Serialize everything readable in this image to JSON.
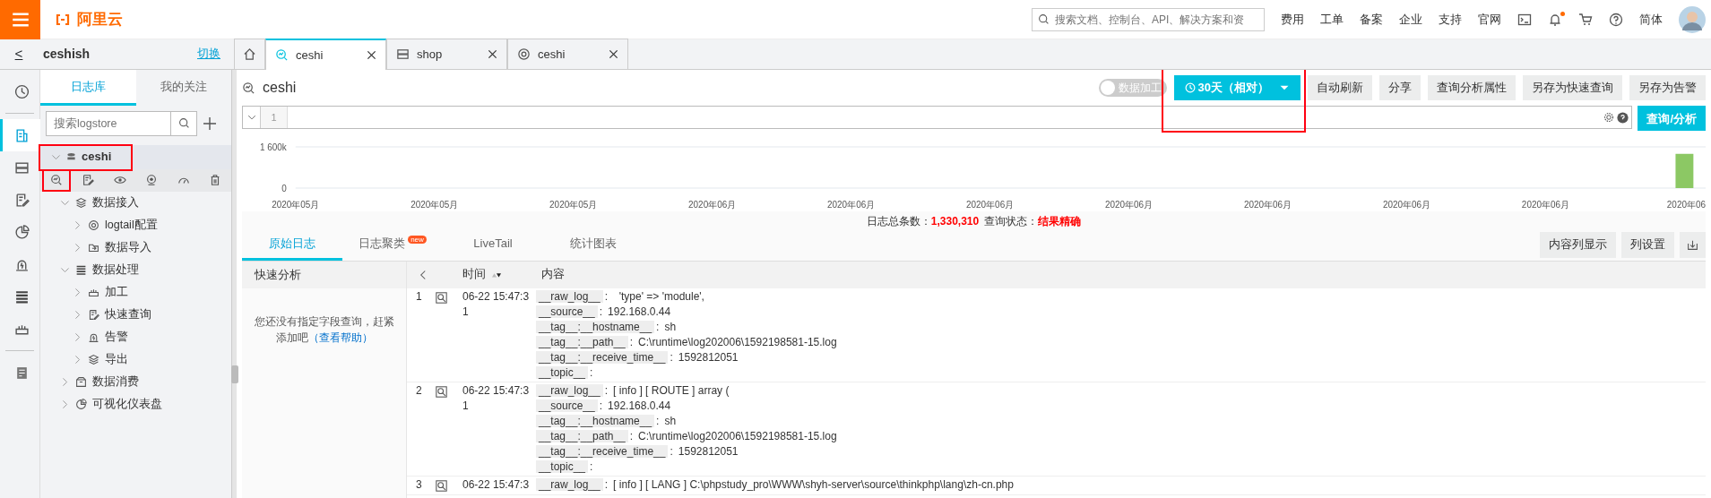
{
  "topbar": {
    "logo": "阿里云",
    "search_placeholder": "搜索文档、控制台、API、解决方案和资",
    "links": [
      "费用",
      "工单",
      "备案",
      "企业",
      "支持",
      "官网"
    ],
    "bell_unread": true,
    "language": "简体"
  },
  "project": {
    "back": "<",
    "name": "ceshish",
    "switch": "切换"
  },
  "tabs": [
    {
      "kind": "home",
      "selected": false,
      "closable": false
    },
    {
      "kind": "search",
      "label": "ceshi",
      "selected": true,
      "closable": true
    },
    {
      "kind": "server",
      "label": "shop",
      "selected": false,
      "closable": true
    },
    {
      "kind": "target",
      "label": "ceshi",
      "selected": false,
      "closable": true
    }
  ],
  "rail": [
    {
      "kind": "clock",
      "selected": false
    },
    {
      "kind": "doc",
      "selected": true
    },
    {
      "kind": "server",
      "selected": false
    },
    {
      "kind": "edit",
      "selected": false
    },
    {
      "kind": "pie",
      "selected": false
    },
    {
      "kind": "alarm",
      "selected": false
    },
    {
      "kind": "list",
      "selected": false
    },
    {
      "kind": "ruler",
      "selected": false
    },
    {
      "kind": "book",
      "selected": false
    }
  ],
  "panel": {
    "tabs": [
      {
        "label": "日志库",
        "selected": true
      },
      {
        "label": "我的关注",
        "selected": false
      }
    ],
    "search_placeholder": "搜索logstore"
  },
  "logstore": {
    "name": "ceshi",
    "expanded": true,
    "annotated": true,
    "actions": [
      {
        "kind": "search",
        "annotated": true
      },
      {
        "kind": "edit",
        "annotated": false
      },
      {
        "kind": "eye",
        "annotated": false
      },
      {
        "kind": "cam",
        "annotated": false
      },
      {
        "kind": "gauge",
        "annotated": false
      },
      {
        "kind": "trash",
        "annotated": false
      }
    ],
    "tree": [
      {
        "label": "数据接入",
        "kind": "stack",
        "expanded": true,
        "children": [
          {
            "label": "logtail配置",
            "kind": "target",
            "expanded": false
          },
          {
            "label": "数据导入",
            "kind": "import",
            "expanded": false
          }
        ]
      },
      {
        "label": "数据处理",
        "kind": "list",
        "expanded": true,
        "children": [
          {
            "label": "加工",
            "kind": "ruler",
            "expanded": false
          },
          {
            "label": "快速查询",
            "kind": "edit",
            "expanded": false
          },
          {
            "label": "告警",
            "kind": "alarm",
            "expanded": false
          },
          {
            "label": "导出",
            "kind": "stack",
            "expanded": false
          }
        ]
      },
      {
        "label": "数据消费",
        "kind": "gift",
        "expanded": false
      },
      {
        "label": "可视化仪表盘",
        "kind": "pie",
        "expanded": false
      }
    ]
  },
  "header": {
    "title": "ceshi",
    "toggle": {
      "label": "数据加工",
      "on": false
    },
    "time_button": {
      "label": "30天（相对）",
      "annotated": true
    },
    "buttons": [
      "自动刷新",
      "分享",
      "查询分析属性",
      "另存为快速查询",
      "另存为告警"
    ]
  },
  "query": {
    "line_number": "1",
    "submit": "查询/分析"
  },
  "histogram": {
    "chart_data": {
      "type": "bar",
      "categories": [
        "2020年05月",
        "2020年05月",
        "2020年05月",
        "2020年06月",
        "2020年06月",
        "2020年06月",
        "2020年06月",
        "2020年06月",
        "2020年06月",
        "2020年06月",
        "2020年06"
      ],
      "yticks": [
        0,
        {
          "value": 1600000,
          "label": "1 600k"
        }
      ],
      "ylim": [
        0,
        1600000
      ],
      "series": [
        {
          "color": "#8cc864",
          "values": [
            null,
            null,
            null,
            null,
            null,
            null,
            null,
            null,
            null,
            null,
            1330000
          ]
        }
      ]
    }
  },
  "summary": {
    "total_label": "日志总条数：",
    "total": "1,330,310",
    "status_label": "查询状态：",
    "status": "结果精确"
  },
  "result_tabs": [
    {
      "label": "原始日志",
      "selected": true
    },
    {
      "label": "日志聚类",
      "selected": false,
      "badge": "new"
    },
    {
      "label": "LiveTail",
      "selected": false
    },
    {
      "label": "统计图表",
      "selected": false
    }
  ],
  "result_buttons": [
    "内容列显示",
    "列设置"
  ],
  "quick_analysis": {
    "title": "快速分析",
    "hint": "您还没有指定字段查询，赶紧添加吧",
    "help_link": "（查看帮助）"
  },
  "table": {
    "columns": [
      "时间",
      "内容"
    ],
    "rows": [
      {
        "index": "1",
        "time": "06-22 15:47:31",
        "fields": [
          {
            "key": "__raw_log__",
            "sep": ":",
            "value": "  'type' => 'module',"
          },
          {
            "key": "__source__",
            "sep": ":",
            "value": "192.168.0.44"
          },
          {
            "key": "__tag__:__hostname__",
            "sep": ":",
            "value": "sh"
          },
          {
            "key": "__tag__:__path__",
            "sep": ":",
            "value": "C:\\runtime\\log202006\\1592198581-15.log"
          },
          {
            "key": "__tag__:__receive_time__",
            "sep": ":",
            "value": "1592812051"
          },
          {
            "key": "__topic__",
            "sep": ":"
          }
        ]
      },
      {
        "index": "2",
        "time": "06-22 15:47:31",
        "fields": [
          {
            "key": "__raw_log__",
            "sep": ":",
            "value": "[ info ] [ ROUTE ] array ("
          },
          {
            "key": "__source__",
            "sep": ":",
            "value": "192.168.0.44"
          },
          {
            "key": "__tag__:__hostname__",
            "sep": ":",
            "value": "sh"
          },
          {
            "key": "__tag__:__path__",
            "sep": ":",
            "value": "C:\\runtime\\log202006\\1592198581-15.log"
          },
          {
            "key": "__tag__:__receive_time__",
            "sep": ":",
            "value": "1592812051"
          },
          {
            "key": "__topic__",
            "sep": ":"
          }
        ]
      },
      {
        "index": "3",
        "time": "06-22 15:47:3",
        "fields": [
          {
            "key": "__raw_log__",
            "sep": ":",
            "value": "[ info ] [ LANG ] C:\\phpstudy_pro\\WWW\\shyh-server\\source\\thinkphp\\lang\\zh-cn.php"
          }
        ]
      }
    ]
  }
}
